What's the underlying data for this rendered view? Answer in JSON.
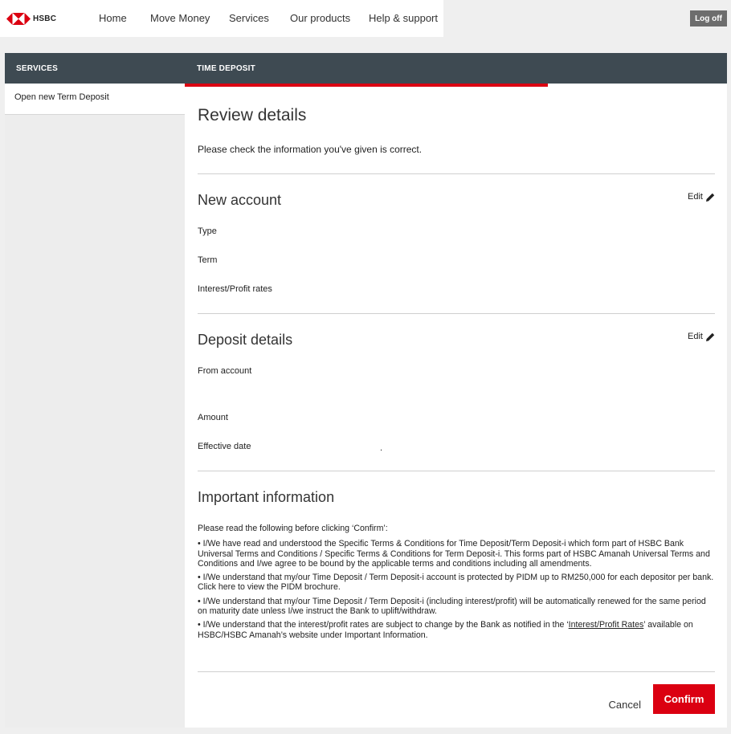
{
  "brand": {
    "name": "HSBC",
    "logo_colors": {
      "red": "#db0011",
      "white": "#ffffff"
    }
  },
  "nav": {
    "items": [
      "Home",
      "Move Money",
      "Services",
      "Our products",
      "Help & support"
    ],
    "logoff": "Log off"
  },
  "sidebar": {
    "header": "SERVICES",
    "items": [
      "Open new Term Deposit"
    ]
  },
  "main": {
    "header": "TIME DEPOSIT",
    "progress_fraction": 0.67,
    "title": "Review details",
    "subtitle": "Please check the information you've given is correct.",
    "new_account": {
      "heading": "New account",
      "edit": "Edit",
      "fields": [
        "Type",
        "Term",
        "Interest/Profit rates"
      ]
    },
    "deposit": {
      "heading": "Deposit details",
      "edit": "Edit",
      "fields": [
        "From account",
        "Amount",
        "Effective date"
      ],
      "effective_date_value": "."
    },
    "important": {
      "heading": "Important information",
      "lead": "Please read the following before clicking ‘Confirm’:",
      "p1": "• I/We have read and understood the Specific Terms & Conditions for Time Deposit/Term Deposit-i which form part of HSBC Bank Universal Terms and Conditions / Specific Terms & Conditions for Term Deposit-i. This forms part of HSBC Amanah Universal Terms and Conditions and I/we agree to be bound by the applicable terms and conditions including all amendments.",
      "p2": "• I/We understand that my/our Time Deposit / Term Deposit-i account is protected by PIDM up to RM250,000 for each depositor per bank. Click here to view the PIDM brochure.",
      "p3": "• I/We understand that my/our Time Deposit / Term Deposit-i (including interest/profit) will be automatically renewed for the same period on maturity date unless I/we instruct the Bank to uplift/withdraw.",
      "p4_pre": "• I/We understand that the interest/profit rates are subject to change by the Bank as notified in the ‘",
      "p4_link": "Interest/Profit Rates",
      "p4_post": "’ available on HSBC/HSBC Amanah’s website under Important Information."
    },
    "actions": {
      "cancel": "Cancel",
      "confirm": "Confirm"
    }
  },
  "colors": {
    "accent": "#db0011",
    "header_bg": "#3e4a52",
    "logoff_bg": "#6d6d6d",
    "page_bg": "#efefef"
  }
}
